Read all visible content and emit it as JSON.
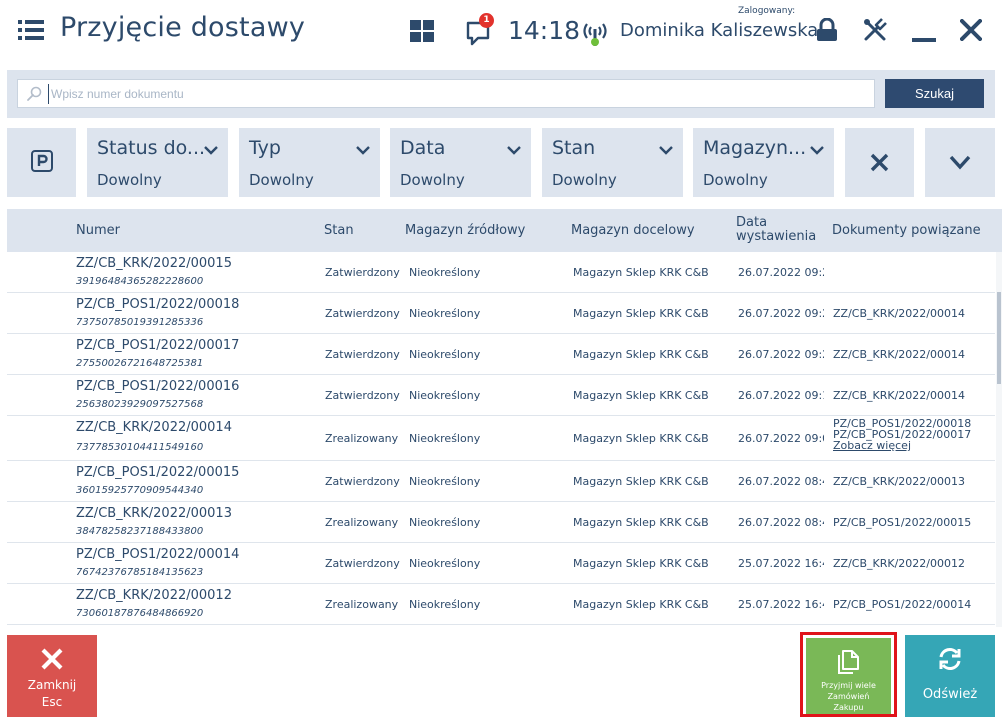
{
  "header": {
    "title": "Przyjęcie dostawy",
    "time": "14:18",
    "notification_count": "1",
    "logged_label": "Zalogowany:",
    "user_name": "Dominika Kaliszewska"
  },
  "search": {
    "placeholder": "Wpisz numer dokumentu",
    "value": "",
    "button_label": "Szukaj"
  },
  "filters": [
    {
      "label": "Status do...",
      "value": "Dowolny"
    },
    {
      "label": "Typ",
      "value": "Dowolny"
    },
    {
      "label": "Data",
      "value": "Dowolny"
    },
    {
      "label": "Stan",
      "value": "Dowolny"
    },
    {
      "label": "Magazyn...",
      "value": "Dowolny"
    }
  ],
  "table": {
    "headers": {
      "numer": "Numer",
      "stan": "Stan",
      "source": "Magazyn źródłowy",
      "target": "Magazyn docelowy",
      "date_line1": "Data",
      "date_line2": "wystawienia",
      "docs": "Dokumenty powiązane"
    },
    "rows": [
      {
        "numer": "ZZ/CB_KRK/2022/00015",
        "code": "3919648436528222860​0",
        "stan": "Zatwierdzony",
        "source": "Nieokreślony",
        "target": "Magazyn Sklep KRK C&B",
        "date": "26.07.2022 09:2",
        "docs": ""
      },
      {
        "numer": "PZ/CB_POS1/2022/00018",
        "code": "73750785019391285336",
        "stan": "Zatwierdzony",
        "source": "Nieokreślony",
        "target": "Magazyn Sklep KRK C&B",
        "date": "26.07.2022 09:2",
        "docs": "ZZ/CB_KRK/2022/00014"
      },
      {
        "numer": "PZ/CB_POS1/2022/00017",
        "code": "27550026721648725381",
        "stan": "Zatwierdzony",
        "source": "Nieokreślony",
        "target": "Magazyn Sklep KRK C&B",
        "date": "26.07.2022 09:2",
        "docs": "ZZ/CB_KRK/2022/00014"
      },
      {
        "numer": "PZ/CB_POS1/2022/00016",
        "code": "25638023929097527568",
        "stan": "Zatwierdzony",
        "source": "Nieokreślony",
        "target": "Magazyn Sklep KRK C&B",
        "date": "26.07.2022 09:1",
        "docs": "ZZ/CB_KRK/2022/00014"
      },
      {
        "numer": "ZZ/CB_KRK/2022/00014",
        "code": "73778530104411549160",
        "stan": "Zrealizowany",
        "source": "Nieokreślony",
        "target": "Magazyn Sklep KRK C&B",
        "date": "26.07.2022 09:0",
        "docs_multi": [
          "PZ/CB_POS1/2022/00018",
          "PZ/CB_POS1/2022/00017"
        ],
        "docs_more": "Zobacz więcej"
      },
      {
        "numer": "PZ/CB_POS1/2022/00015",
        "code": "36015925770909544340",
        "stan": "Zatwierdzony",
        "source": "Nieokreślony",
        "target": "Magazyn Sklep KRK C&B",
        "date": "26.07.2022 08:4",
        "docs": "ZZ/CB_KRK/2022/00013"
      },
      {
        "numer": "ZZ/CB_KRK/2022/00013",
        "code": "38478258237188433800",
        "stan": "Zrealizowany",
        "source": "Nieokreślony",
        "target": "Magazyn Sklep KRK C&B",
        "date": "26.07.2022 08:4",
        "docs": "PZ/CB_POS1/2022/00015"
      },
      {
        "numer": "PZ/CB_POS1/2022/00014",
        "code": "76742376785184135623",
        "stan": "Zatwierdzony",
        "source": "Nieokreślony",
        "target": "Magazyn Sklep KRK C&B",
        "date": "25.07.2022 16:4",
        "docs": "ZZ/CB_KRK/2022/00012"
      },
      {
        "numer": "ZZ/CB_KRK/2022/00012",
        "code": "73060187876484866920",
        "stan": "Zrealizowany",
        "source": "Nieokreślony",
        "target": "Magazyn Sklep KRK C&B",
        "date": "25.07.2022 16:4",
        "docs": "PZ/CB_POS1/2022/00014"
      }
    ]
  },
  "buttons": {
    "close_line1": "Zamknij",
    "close_line2": "Esc",
    "accept_line1": "Przyjmij wiele",
    "accept_line2": "Zamówień",
    "accept_line3": "Zakupu",
    "refresh": "Odśwież"
  },
  "colors": {
    "primary_text": "#2d4a6b",
    "panel_bg": "#dde4ee",
    "search_button": "#2e4a70",
    "close_button": "#d9534f",
    "accept_button": "#7ab857",
    "accept_highlight": "#e0131a",
    "refresh_button": "#35a6b6",
    "badge": "#e2322c"
  }
}
